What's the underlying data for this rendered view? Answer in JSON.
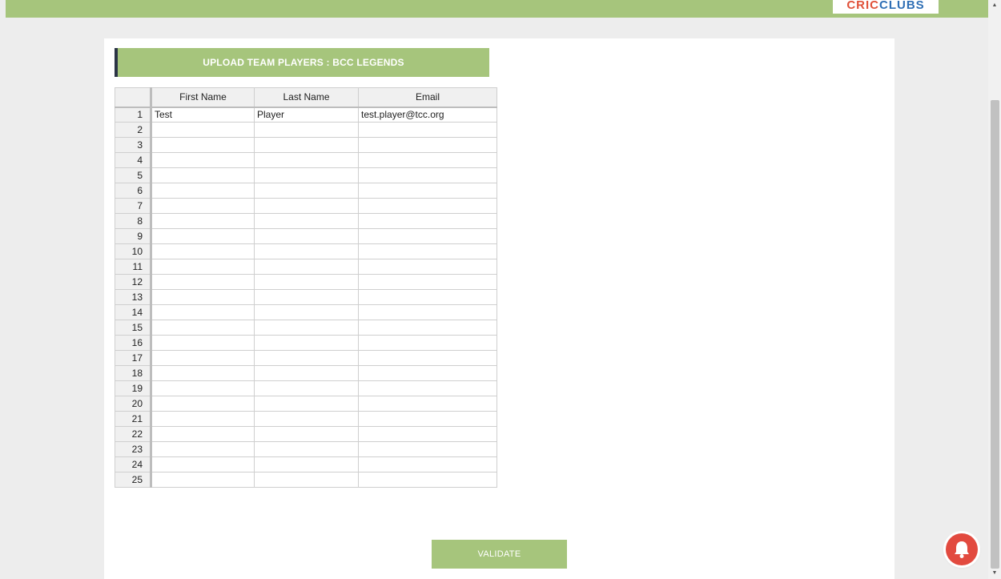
{
  "header": {
    "logo_cric": "CRIC",
    "logo_clubs": "CLUBS"
  },
  "page": {
    "title": "UPLOAD TEAM PLAYERS : BCC LEGENDS"
  },
  "grid": {
    "columns": [
      "First Name",
      "Last Name",
      "Email"
    ],
    "rows": [
      {
        "num": "1",
        "first": "Test",
        "last": "Player",
        "email": "test.player@tcc.org"
      },
      {
        "num": "2",
        "first": "",
        "last": "",
        "email": ""
      },
      {
        "num": "3",
        "first": "",
        "last": "",
        "email": ""
      },
      {
        "num": "4",
        "first": "",
        "last": "",
        "email": ""
      },
      {
        "num": "5",
        "first": "",
        "last": "",
        "email": ""
      },
      {
        "num": "6",
        "first": "",
        "last": "",
        "email": ""
      },
      {
        "num": "7",
        "first": "",
        "last": "",
        "email": ""
      },
      {
        "num": "8",
        "first": "",
        "last": "",
        "email": ""
      },
      {
        "num": "9",
        "first": "",
        "last": "",
        "email": ""
      },
      {
        "num": "10",
        "first": "",
        "last": "",
        "email": ""
      },
      {
        "num": "11",
        "first": "",
        "last": "",
        "email": ""
      },
      {
        "num": "12",
        "first": "",
        "last": "",
        "email": ""
      },
      {
        "num": "13",
        "first": "",
        "last": "",
        "email": ""
      },
      {
        "num": "14",
        "first": "",
        "last": "",
        "email": ""
      },
      {
        "num": "15",
        "first": "",
        "last": "",
        "email": ""
      },
      {
        "num": "16",
        "first": "",
        "last": "",
        "email": ""
      },
      {
        "num": "17",
        "first": "",
        "last": "",
        "email": ""
      },
      {
        "num": "18",
        "first": "",
        "last": "",
        "email": ""
      },
      {
        "num": "19",
        "first": "",
        "last": "",
        "email": ""
      },
      {
        "num": "20",
        "first": "",
        "last": "",
        "email": ""
      },
      {
        "num": "21",
        "first": "",
        "last": "",
        "email": ""
      },
      {
        "num": "22",
        "first": "",
        "last": "",
        "email": ""
      },
      {
        "num": "23",
        "first": "",
        "last": "",
        "email": ""
      },
      {
        "num": "24",
        "first": "",
        "last": "",
        "email": ""
      },
      {
        "num": "25",
        "first": "",
        "last": "",
        "email": ""
      }
    ]
  },
  "actions": {
    "validate_label": "VALIDATE"
  },
  "colors": {
    "accent_green": "#a6c57c",
    "banner_border": "#2b3446",
    "notification_red": "#e24a3f"
  },
  "icons": {
    "notification": "bell-icon"
  }
}
